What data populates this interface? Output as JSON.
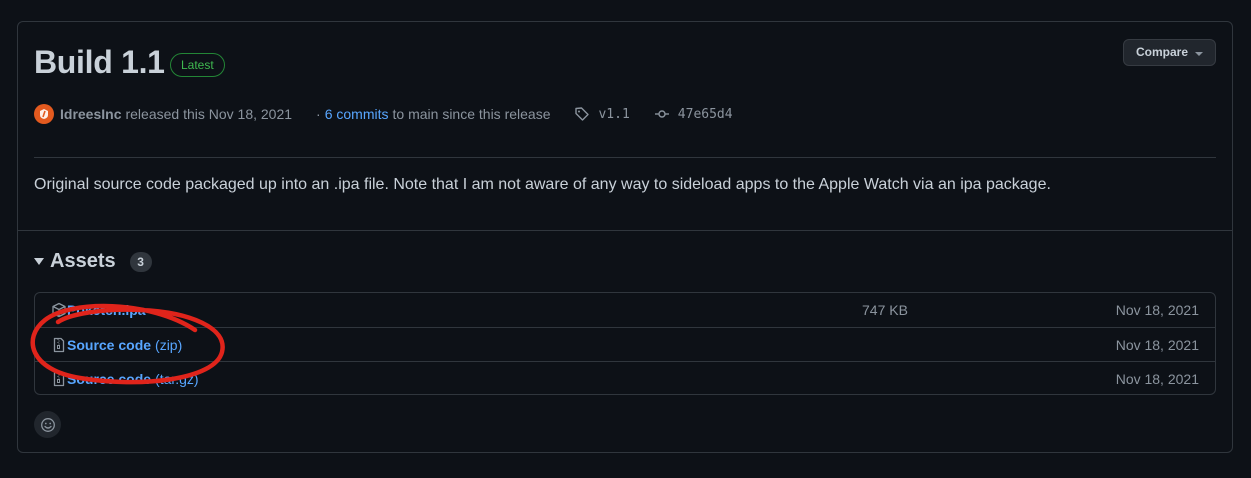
{
  "release": {
    "title": "Build 1.1",
    "badge": "Latest",
    "compare_label": "Compare",
    "author": "IdreesInc",
    "released_text": "released this Nov 18, 2021",
    "separator": "·",
    "commits_link": "6 commits",
    "commits_suffix": "to main since this release",
    "tag": "v1.1",
    "commit_hash": "47e65d4",
    "description": "Original source code packaged up into an .ipa file. Note that I am not aware of any way to sideload apps to the Apple Watch via an ipa package."
  },
  "assets": {
    "heading": "Assets",
    "count": "3",
    "items": [
      {
        "name": "Poketch.ipa",
        "ext": "",
        "size": "747 KB",
        "date": "Nov 18, 2021",
        "icon": "package-icon"
      },
      {
        "name": "Source code",
        "ext": "(zip)",
        "size": "",
        "date": "Nov 18, 2021",
        "icon": "file-zip-icon"
      },
      {
        "name": "Source code",
        "ext": "(tar.gz)",
        "size": "",
        "date": "Nov 18, 2021",
        "icon": "file-zip-icon"
      }
    ]
  },
  "colors": {
    "background": "#0d1117",
    "link": "#58a6ff",
    "badge_green": "#3fb950",
    "annotation_red": "#e0241b"
  }
}
